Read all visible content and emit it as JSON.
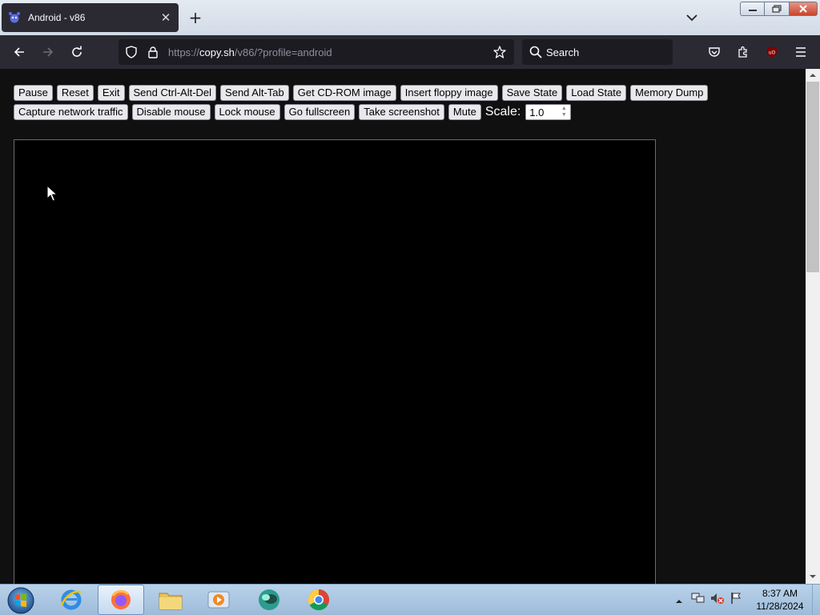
{
  "browser": {
    "tab_title": "Android - v86",
    "url_prefix": "https://",
    "url_domain": "copy.sh",
    "url_path": "/v86/?profile=android",
    "search_placeholder": "Search"
  },
  "toolbar": {
    "row1": [
      "Pause",
      "Reset",
      "Exit",
      "Send Ctrl-Alt-Del",
      "Send Alt-Tab",
      "Get CD-ROM image",
      "Insert floppy image",
      "Save State",
      "Load State",
      "Memory Dump"
    ],
    "row2": [
      "Capture network traffic",
      "Disable mouse",
      "Lock mouse",
      "Go fullscreen",
      "Take screenshot",
      "Mute"
    ],
    "scale_label": "Scale:",
    "scale_value": "1.0"
  },
  "taskbar": {
    "time": "8:37 AM",
    "date": "11/28/2024"
  },
  "colors": {
    "browser_chrome": "#2b2a33",
    "page_background": "#101010",
    "emulator_screen": "#000000"
  }
}
